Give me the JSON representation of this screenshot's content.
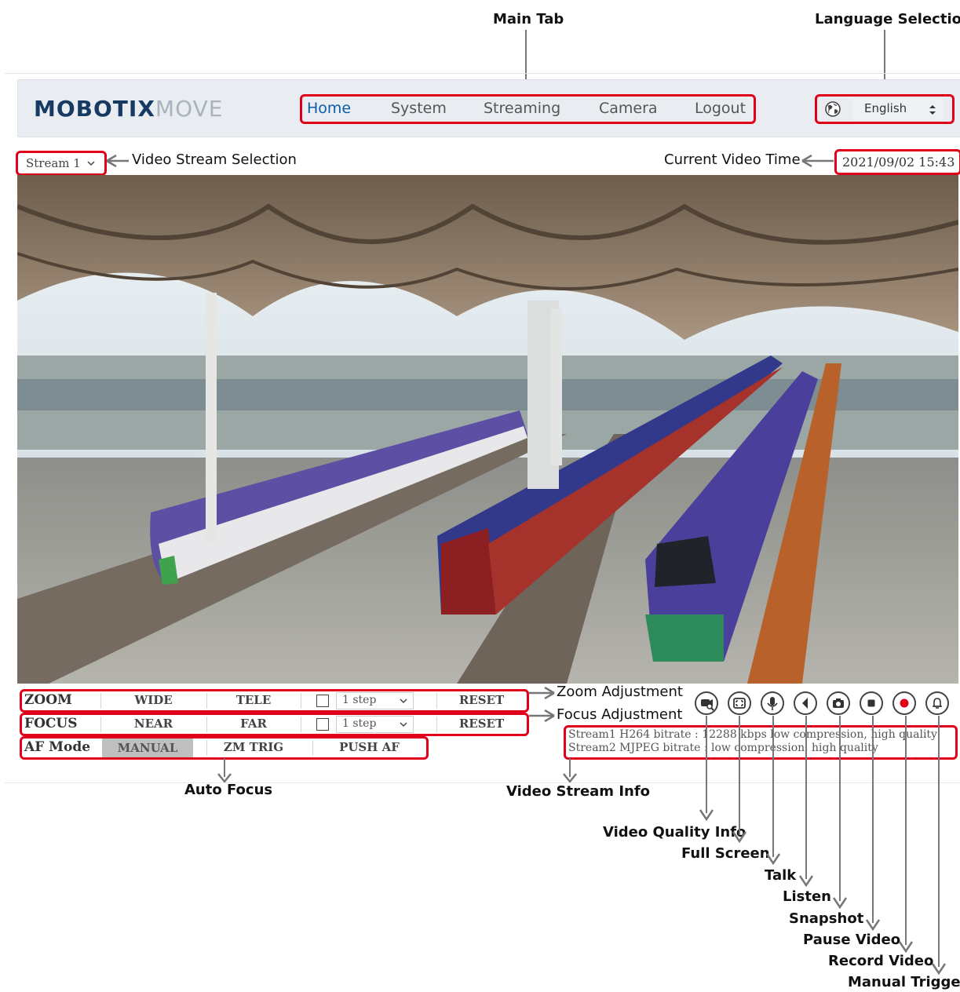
{
  "annotations": {
    "main_tab": "Main Tab",
    "language_selection": "Language Selection",
    "video_stream_selection": "Video Stream Selection",
    "current_video_time": "Current Video Time",
    "zoom_adjustment": "Zoom Adjustment",
    "focus_adjustment": "Focus Adjustment",
    "auto_focus": "Auto Focus",
    "video_stream_info": "Video Stream Info",
    "video_quality_info": "Video Quality Info",
    "full_screen": "Full Screen",
    "talk": "Talk",
    "listen": "Listen",
    "snapshot": "Snapshot",
    "pause_video": "Pause Video",
    "record_video": "Record Video",
    "manual_trigger": "Manual Trigger"
  },
  "header": {
    "logo_bold": "MOBOTIX",
    "logo_light": "MOVE",
    "tabs": [
      "Home",
      "System",
      "Streaming",
      "Camera",
      "Logout"
    ],
    "active_tab": "Home",
    "language": "English"
  },
  "stream_select": "Stream 1",
  "video_time": "2021/09/02 15:43",
  "zoom": {
    "label": "ZOOM",
    "wide": "WIDE",
    "tele": "TELE",
    "step": "1 step",
    "reset": "RESET"
  },
  "focus": {
    "label": "FOCUS",
    "near": "NEAR",
    "far": "FAR",
    "step": "1 step",
    "reset": "RESET"
  },
  "af": {
    "label": "AF Mode",
    "manual": "MANUAL",
    "zm_trig": "ZM TRIG",
    "push_af": "PUSH AF"
  },
  "stream_info": {
    "line1": "Stream1 H264 bitrate : 12288 kbps low compression, high quality",
    "line2": "Stream2 MJPEG bitrate : low compression, high quality"
  },
  "colors": {
    "highlight": "#e0001a",
    "accent": "#0a5da8",
    "record": "#e0001a"
  },
  "icons": [
    "video-quality-icon",
    "full-screen-icon",
    "talk-icon",
    "listen-icon",
    "snapshot-icon",
    "pause-icon",
    "record-icon",
    "trigger-icon"
  ]
}
